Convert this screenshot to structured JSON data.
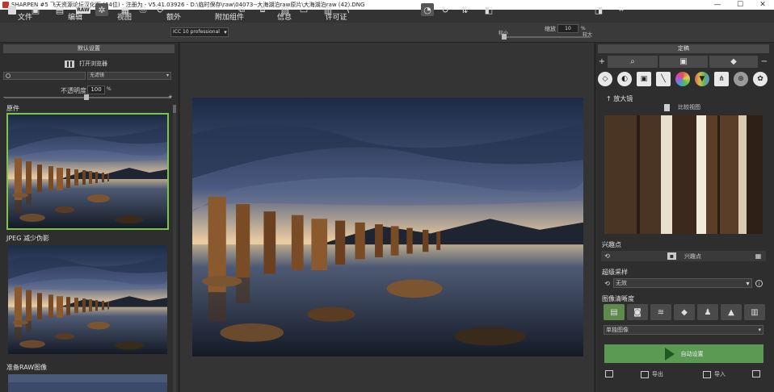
{
  "window": {
    "title": "SHARPEN #5 飞天资源论坛汉化版 (64位) - 注册为 - V5.41.03926 - D:\\临时保存\\raw\\04073--大海湖泊raw原片\\大海湖泊raw (42).DNG",
    "controls": [
      "—",
      "☐",
      "✕"
    ]
  },
  "menu": [
    "文件",
    "编辑",
    "视图",
    "额外",
    "附加组件",
    "信息",
    "许可证"
  ],
  "toolbar": {
    "profile": "ICC 10 professional",
    "zoom_label": "缩放",
    "zoom_value": "10",
    "zoom_unit": "%",
    "small_label": "较小",
    "large_label": "较大",
    "zoom_level_fraction": 0.0
  },
  "left": {
    "default_settings": "默认设置",
    "open_browser": "打开浏览器",
    "filter_value": "无滤镜",
    "opacity_label": "不透明度",
    "opacity_value": "100",
    "opacity_unit": "%",
    "opacity_fraction": 0.5,
    "presets": [
      {
        "label": "原件",
        "selected": true
      },
      {
        "label": "JPEG 减少伪影",
        "selected": false
      },
      {
        "label": "准备RAW图像",
        "selected": false
      }
    ]
  },
  "right": {
    "header": "定稿",
    "bar_icons": [
      "plus-icon",
      "magnifier-icon",
      "image-icon",
      "diamond-icon",
      "minus-icon"
    ],
    "tool_icons": [
      {
        "name": "gem-icon",
        "color": "#e8e8e8"
      },
      {
        "name": "half-circle-icon",
        "color": "#e8e8e8"
      },
      {
        "name": "frame-icon",
        "color": "#e8e8e8"
      },
      {
        "name": "wand-icon",
        "color": "#e8e8e8"
      },
      {
        "name": "color-wheel-icon",
        "color": "#d86a6a"
      },
      {
        "name": "prism-icon",
        "color": "#c0a040"
      },
      {
        "name": "network-icon",
        "color": "#e8e8e8"
      },
      {
        "name": "zoom-detail-icon",
        "color": "#9a9a9a"
      },
      {
        "name": "settings-icon",
        "color": "#e8e8e8"
      }
    ],
    "magnifier_title": "放大镜",
    "compare_label": "比较视图",
    "interest_title": "兴趣点",
    "interest_label": "兴趣点",
    "supersampling_title": "超级采样",
    "supersampling_value": "无效",
    "sharpness_title": "图像清晰度",
    "sharpness_select": "单独图像",
    "auto_label": "自动设置",
    "export_label": "导出",
    "import_label": "导入"
  }
}
